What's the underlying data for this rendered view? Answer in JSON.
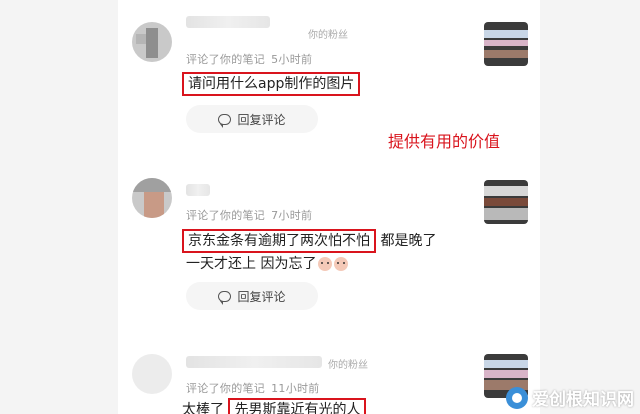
{
  "comments": [
    {
      "fan_tag": "你的粉丝",
      "action": "评论了你的笔记",
      "time": "5小时前",
      "text_highlight": "请问用什么app制作的图片",
      "reply_label": "回复评论"
    },
    {
      "action": "评论了你的笔记",
      "time": "7小时前",
      "text_highlight": "京东金条有逾期了两次怕不怕",
      "text_rest": "都是晚了",
      "text_line2": "一天才还上  因为忘了",
      "reply_label": "回复评论"
    },
    {
      "fan_tag": "你的粉丝",
      "action": "评论了你的笔记",
      "time": "11小时前",
      "text_prefix": "太棒了",
      "text_highlight": "先男斯靠近有光的人"
    }
  ],
  "annotation": "提供有用的价值",
  "watermark": {
    "text": "爱创根知识网",
    "logo_icon": "knowledge-site-logo"
  },
  "colors": {
    "highlight": "#d9141d",
    "meta": "#999999"
  }
}
